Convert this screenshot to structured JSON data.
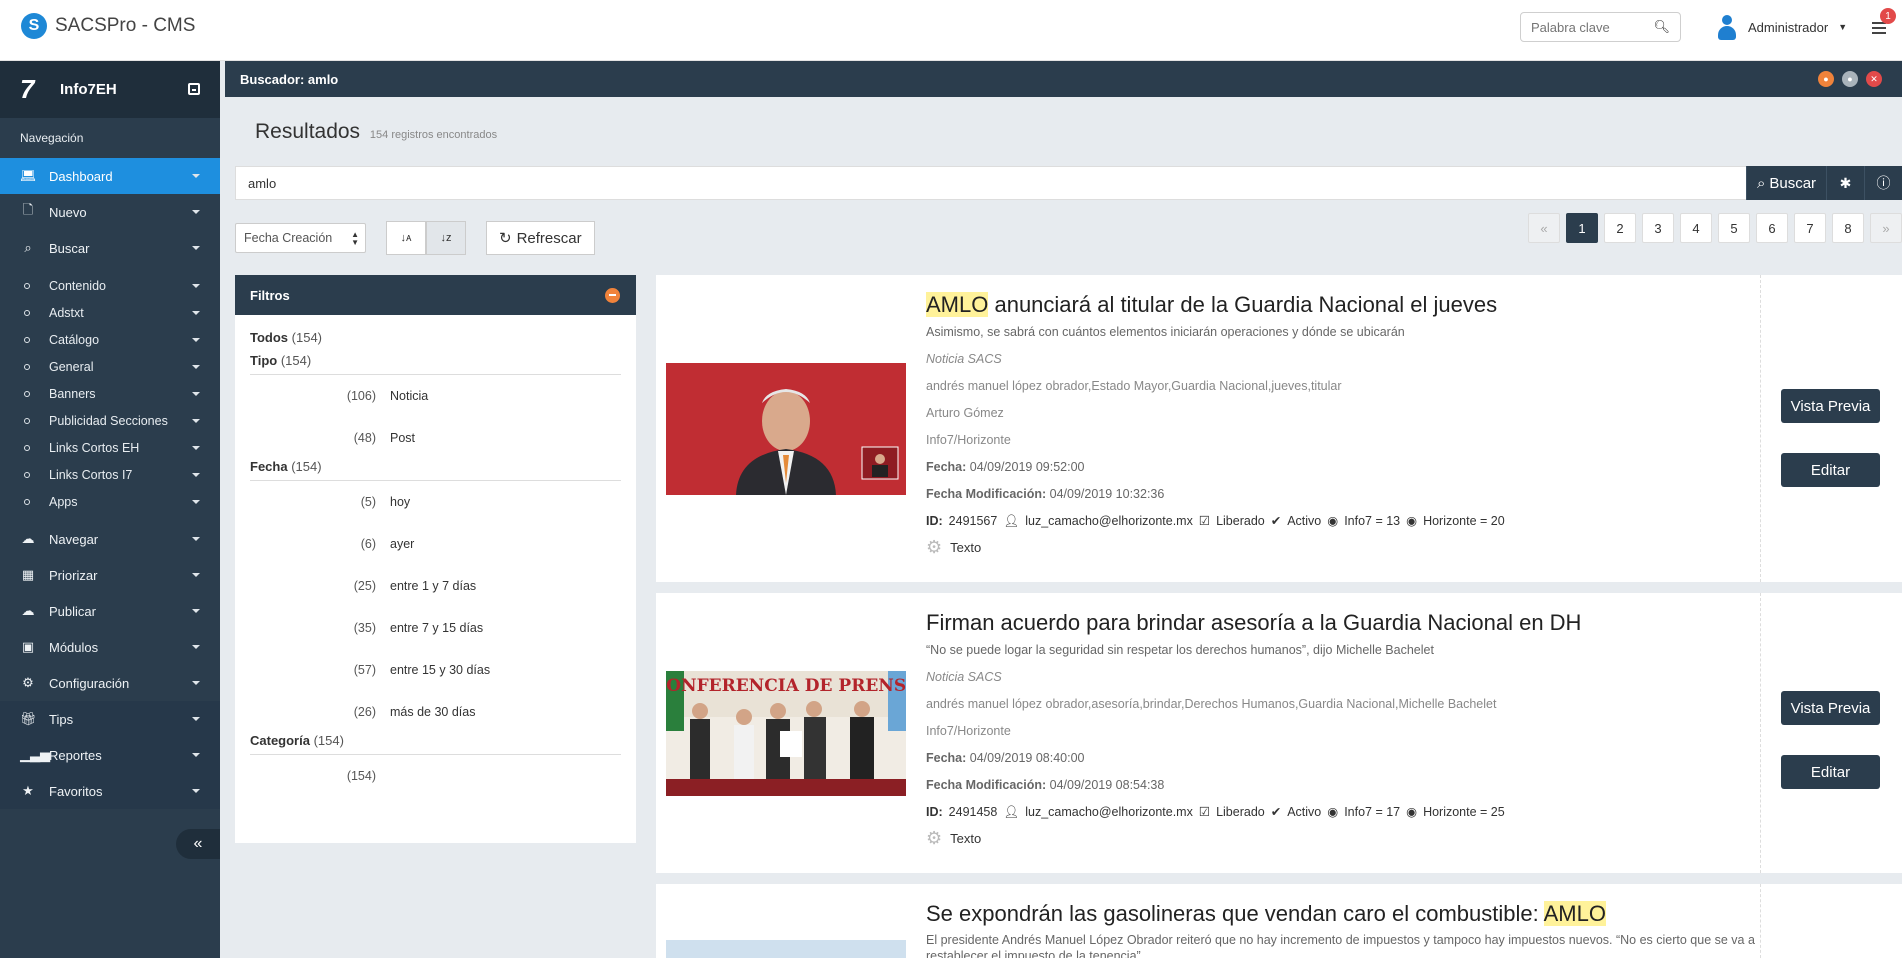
{
  "app": {
    "logo_letter": "S",
    "name": "SACSPro - CMS"
  },
  "header": {
    "search_placeholder": "Palabra clave",
    "search_icon": "search-icon",
    "user": "Administrador",
    "notif_count": "1"
  },
  "sidebar": {
    "site_logo": "7",
    "site": "Info7EH",
    "section": "Navegación",
    "items_top": [
      {
        "label": "Dashboard",
        "icon": "laptop-icon"
      },
      {
        "label": "Nuevo",
        "icon": "file-icon"
      },
      {
        "label": "Buscar",
        "icon": "search-icon"
      }
    ],
    "sub_items": [
      "Contenido",
      "Adstxt",
      "Catálogo",
      "General",
      "Banners",
      "Publicidad Secciones",
      "Links Cortos EH",
      "Links Cortos I7",
      "Apps"
    ],
    "items_bottom": [
      {
        "label": "Navegar",
        "icon": "cloud-icon"
      },
      {
        "label": "Priorizar",
        "icon": "grid-icon"
      },
      {
        "label": "Publicar",
        "icon": "cloud-upload-icon"
      },
      {
        "label": "Módulos",
        "icon": "briefcase-icon"
      },
      {
        "label": "Configuración",
        "icon": "gears-icon"
      },
      {
        "label": "Tips",
        "icon": "gift-icon"
      },
      {
        "label": "Reportes",
        "icon": "chart-icon"
      },
      {
        "label": "Favoritos",
        "icon": "star-icon"
      }
    ],
    "collapse": "«"
  },
  "panel": {
    "title": "Buscador: amlo"
  },
  "results": {
    "title": "Resultados",
    "count": "154 registros encontrados"
  },
  "search": {
    "value": "amlo",
    "button": "Buscar"
  },
  "controls": {
    "sort_field": "Fecha Creación",
    "refresh": "Refrescar"
  },
  "pager": {
    "prev": "«",
    "pages": [
      "1",
      "2",
      "3",
      "4",
      "5",
      "6",
      "7",
      "8"
    ],
    "next": "»",
    "current": "1"
  },
  "filters": {
    "title": "Filtros",
    "todos": {
      "label": "Todos",
      "count": "(154)"
    },
    "tipo": {
      "label": "Tipo",
      "count": "(154)",
      "rows": [
        {
          "count": "(106)",
          "label": "Noticia"
        },
        {
          "count": "(48)",
          "label": "Post"
        }
      ]
    },
    "fecha": {
      "label": "Fecha",
      "count": "(154)",
      "rows": [
        {
          "count": "(5)",
          "label": "hoy"
        },
        {
          "count": "(6)",
          "label": "ayer"
        },
        {
          "count": "(25)",
          "label": "entre 1 y 7 días"
        },
        {
          "count": "(35)",
          "label": "entre 7 y 15 días"
        },
        {
          "count": "(57)",
          "label": "entre 15 y 30 días"
        },
        {
          "count": "(26)",
          "label": "más de 30 días"
        }
      ]
    },
    "categoria": {
      "label": "Categoría",
      "count": "(154)",
      "rows": [
        {
          "count": "(154)",
          "label": ""
        }
      ]
    }
  },
  "cards": [
    {
      "title_hl": "AMLO",
      "title_rest": " anunciará al titular de la Guardia Nacional el jueves",
      "summary": "Asimismo, se sabrá con cuántos elementos iniciarán operaciones y dónde se ubicarán",
      "source": "Noticia SACS",
      "tags": "andrés manuel lópez obrador,Estado Mayor,Guardia Nacional,jueves,titular",
      "author": "Arturo Gómez",
      "section": "Info7/Horizonte",
      "fecha_label": "Fecha:",
      "fecha": "04/09/2019 09:52:00",
      "fmod_label": "Fecha Modificación:",
      "fmod": "04/09/2019 10:32:36",
      "id_label": "ID:",
      "id": "2491567",
      "email": "luz_camacho@elhorizonte.mx",
      "liberado": "Liberado",
      "activo": "Activo",
      "info7": "Info7 = 13",
      "horizonte": "Horizonte = 20",
      "texto": "Texto",
      "preview": "Vista Previa",
      "edit": "Editar"
    },
    {
      "title_hl": "",
      "title_rest": "Firman acuerdo para brindar asesoría a la Guardia Nacional en DH",
      "summary": "“No se puede logar la seguridad sin respetar los derechos humanos”, dijo Michelle Bachelet",
      "source": "Noticia SACS",
      "tags": "andrés manuel lópez obrador,asesoría,brindar,Derechos Humanos,Guardia Nacional,Michelle Bachelet",
      "section": "Info7/Horizonte",
      "fecha_label": "Fecha:",
      "fecha": "04/09/2019 08:40:00",
      "fmod_label": "Fecha Modificación:",
      "fmod": "04/09/2019 08:54:38",
      "id_label": "ID:",
      "id": "2491458",
      "email": "luz_camacho@elhorizonte.mx",
      "liberado": "Liberado",
      "activo": "Activo",
      "info7": "Info7 = 17",
      "horizonte": "Horizonte = 25",
      "texto": "Texto",
      "preview": "Vista Previa",
      "edit": "Editar",
      "banner_text": "CONFERENCIA DE PRENSA"
    },
    {
      "title_pre": "Se expondrán las gasolineras que vendan caro el combustible: ",
      "title_hl": "AMLO",
      "summary": "El presidente Andrés Manuel López Obrador reiteró que no hay incremento de impuestos y tampoco hay impuestos nuevos. “No es cierto que se va a restablecer el impuesto de la tenencia”"
    }
  ],
  "colors": {
    "accent": "#1e8fdf",
    "dark": "#2b3d4d",
    "highlight": "#fff29a",
    "orange": "#f0833b"
  }
}
